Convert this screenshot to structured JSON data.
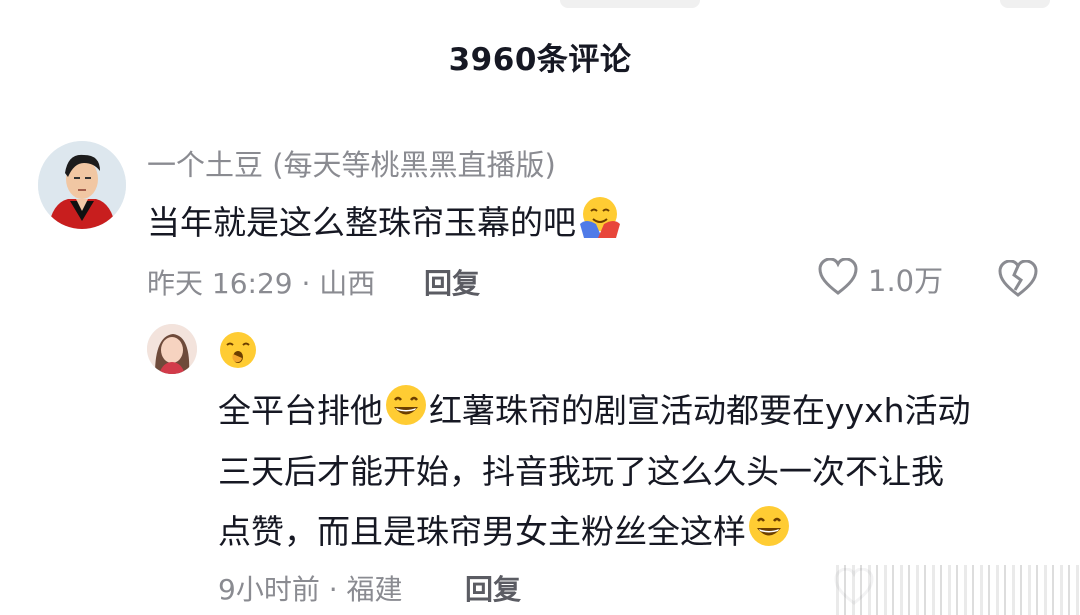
{
  "header": {
    "title": "3960条评论"
  },
  "comments": [
    {
      "username": "一个土豆 (每天等桃黑黑直播版)",
      "text": "当年就是这么整珠帘玉幕的吧",
      "emoji": "hug-face-emoji",
      "time": "昨天 16:29",
      "location": "山西",
      "meta": "昨天 16:29 · 山西",
      "reply_label": "回复",
      "like_count": "1.0万"
    }
  ],
  "replies": [
    {
      "username_emoji": "yawn-face-emoji",
      "lines": [
        {
          "before": "全平台排他",
          "emoji": "grin-face-emoji",
          "after": "红薯珠帘的剧宣活动都要在yyxh活动"
        },
        {
          "text": "三天后才能开始，抖音我玩了这么久头一次不让我"
        },
        {
          "before": "点赞，而且是珠帘男女主粉丝全这样",
          "emoji": "grin-face-emoji",
          "after": ""
        }
      ],
      "meta": "9小时前 · 福建",
      "reply_label": "回复"
    }
  ],
  "colors": {
    "primary_text": "#161823",
    "secondary_text": "#8a8b91",
    "background": "#ffffff"
  }
}
